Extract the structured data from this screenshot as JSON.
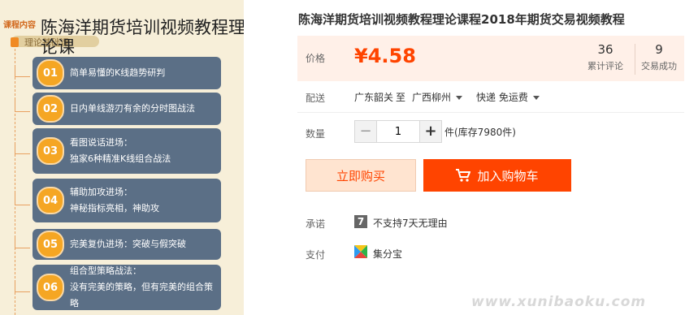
{
  "image_panel": {
    "course_tab": "课程内容",
    "overlay_title": "陈海洋期货培训视频教程理论课",
    "basic_label": "理论基础课",
    "modules": [
      {
        "num": "01",
        "text": "简单易懂的K线趋势研判"
      },
      {
        "num": "02",
        "text": "日内单线游刃有余的分时图战法"
      },
      {
        "num": "03",
        "text": "看图说话进场：\n独家6种精准K线组合战法"
      },
      {
        "num": "04",
        "text": "辅助加攻进场：\n神秘指标亮相，神助攻"
      },
      {
        "num": "05",
        "text": "完美复仇进场：突破与假突破"
      },
      {
        "num": "06",
        "text": "组合型策略战法：\n没有完美的策略，但有完美的组合策略"
      }
    ]
  },
  "product": {
    "title": "陈海洋期货培训视频教程理论课程2018年期货交易视频教程",
    "price_label": "价格",
    "price": "¥4.58",
    "reviews_count": "36",
    "reviews_label": "累计评论",
    "sales_count": "9",
    "sales_label": "交易成功"
  },
  "shipping": {
    "label": "配送",
    "from": "广东韶关",
    "to_word": "至",
    "to": "广西柳州",
    "method": "快递 免运费"
  },
  "quantity": {
    "label": "数量",
    "minus": "−",
    "value": "1",
    "plus": "+",
    "stock": "件(库存7980件)"
  },
  "actions": {
    "buy_now": "立即购买",
    "add_to_cart": "加入购物车"
  },
  "promise": {
    "label": "承诺",
    "icon_text": "7",
    "text": "不支持7天无理由"
  },
  "payment": {
    "label": "支付",
    "text": "集分宝"
  },
  "watermark": "www.xunibaoku.com",
  "colors": {
    "accent": "#ff4400",
    "price_bg": "#fff0e8",
    "module_bg": "#5b6f86",
    "module_num": "#f5a623"
  }
}
